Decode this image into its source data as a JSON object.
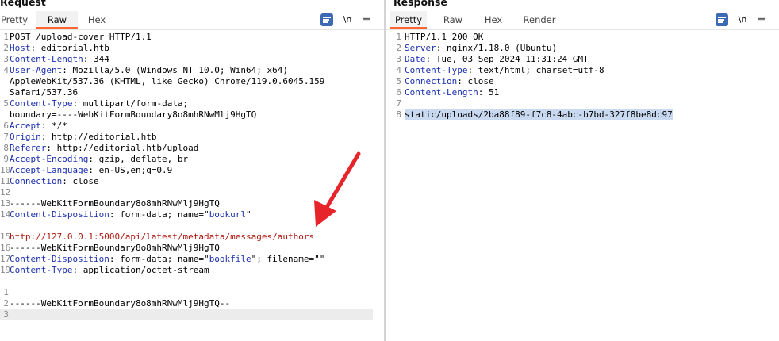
{
  "request": {
    "title": "Request",
    "tabs": [
      "Pretty",
      "Raw",
      "Hex"
    ],
    "active_tab": "Raw",
    "toolbar": {
      "newline_label": "\\n",
      "menu_label": "≡"
    },
    "lines": [
      {
        "num": "1",
        "parts": [
          {
            "t": "POST /upload-cover HTTP/1.1",
            "c": ""
          }
        ]
      },
      {
        "num": "2",
        "parts": [
          {
            "t": "Host",
            "c": "hn"
          },
          {
            "t": ": editorial.htb",
            "c": ""
          }
        ]
      },
      {
        "num": "3",
        "parts": [
          {
            "t": "Content-Length",
            "c": "hn"
          },
          {
            "t": ": 344",
            "c": ""
          }
        ]
      },
      {
        "num": "4",
        "parts": [
          {
            "t": "User-Agent",
            "c": "hn"
          },
          {
            "t": ": Mozilla/5.0 (Windows NT 10.0; Win64; x64)",
            "c": ""
          }
        ]
      },
      {
        "num": "",
        "parts": [
          {
            "t": "AppleWebKit/537.36 (KHTML, like Gecko) Chrome/119.0.6045.159",
            "c": ""
          }
        ]
      },
      {
        "num": "",
        "parts": [
          {
            "t": "Safari/537.36",
            "c": ""
          }
        ]
      },
      {
        "num": "5",
        "parts": [
          {
            "t": "Content-Type",
            "c": "hn"
          },
          {
            "t": ": multipart/form-data;",
            "c": ""
          }
        ]
      },
      {
        "num": "",
        "parts": [
          {
            "t": "boundary=----WebKitFormBoundary8o8mhRNwMlj9HgTQ",
            "c": ""
          }
        ]
      },
      {
        "num": "6",
        "parts": [
          {
            "t": "Accept",
            "c": "hn"
          },
          {
            "t": ": */*",
            "c": ""
          }
        ]
      },
      {
        "num": "7",
        "parts": [
          {
            "t": "Origin",
            "c": "hn"
          },
          {
            "t": ": http://editorial.htb",
            "c": ""
          }
        ]
      },
      {
        "num": "8",
        "parts": [
          {
            "t": "Referer",
            "c": "hn"
          },
          {
            "t": ": http://editorial.htb/upload",
            "c": ""
          }
        ]
      },
      {
        "num": "9",
        "parts": [
          {
            "t": "Accept-Encoding",
            "c": "hn"
          },
          {
            "t": ": gzip, deflate, br",
            "c": ""
          }
        ]
      },
      {
        "num": "10",
        "parts": [
          {
            "t": "Accept-Language",
            "c": "hn"
          },
          {
            "t": ": en-US,en;q=0.9",
            "c": ""
          }
        ]
      },
      {
        "num": "11",
        "parts": [
          {
            "t": "Connection",
            "c": "hn"
          },
          {
            "t": ": close",
            "c": ""
          }
        ]
      },
      {
        "num": "12",
        "parts": []
      },
      {
        "num": "13",
        "parts": [
          {
            "t": "------WebKitFormBoundary8o8mhRNwMlj9HgTQ",
            "c": ""
          }
        ]
      },
      {
        "num": "14",
        "parts": [
          {
            "t": "Content-Disposition",
            "c": "hn"
          },
          {
            "t": ": form-data; name=\"",
            "c": ""
          },
          {
            "t": "bookurl",
            "c": "hn"
          },
          {
            "t": "\"",
            "c": ""
          }
        ]
      },
      {
        "num": "",
        "parts": []
      },
      {
        "num": "15",
        "parts": [
          {
            "t": "http://127.0.0.1:5000/api/latest/metadata/messages/authors",
            "c": "url"
          }
        ]
      },
      {
        "num": "16",
        "parts": [
          {
            "t": "------WebKitFormBoundary8o8mhRNwMlj9HgTQ",
            "c": ""
          }
        ]
      },
      {
        "num": "17",
        "parts": [
          {
            "t": "Content-Disposition",
            "c": "hn"
          },
          {
            "t": ": form-data; name=\"",
            "c": ""
          },
          {
            "t": "bookfile",
            "c": "hn"
          },
          {
            "t": "\"; filename=\"\"",
            "c": ""
          }
        ]
      },
      {
        "num": "19",
        "parts": [
          {
            "t": "Content-Type",
            "c": "hn"
          },
          {
            "t": ": application/octet-stream",
            "c": ""
          }
        ]
      },
      {
        "num": "",
        "parts": []
      },
      {
        "num": "1",
        "parts": []
      },
      {
        "num": "2",
        "parts": [
          {
            "t": "------WebKitFormBoundary8o8mhRNwMlj9HgTQ--",
            "c": ""
          }
        ]
      },
      {
        "num": "3",
        "parts": []
      }
    ]
  },
  "response": {
    "title": "Response",
    "tabs": [
      "Pretty",
      "Raw",
      "Hex",
      "Render"
    ],
    "active_tab": "Pretty",
    "toolbar": {
      "newline_label": "\\n",
      "menu_label": "≡"
    },
    "lines": [
      {
        "num": "1",
        "parts": [
          {
            "t": "HTTP/1.1 200 OK",
            "c": ""
          }
        ]
      },
      {
        "num": "2",
        "parts": [
          {
            "t": "Server",
            "c": "hn"
          },
          {
            "t": ": nginx/1.18.0 (Ubuntu)",
            "c": ""
          }
        ]
      },
      {
        "num": "3",
        "parts": [
          {
            "t": "Date",
            "c": "hn"
          },
          {
            "t": ": Tue, 03 Sep 2024 11:31:24 GMT",
            "c": ""
          }
        ]
      },
      {
        "num": "4",
        "parts": [
          {
            "t": "Content-Type",
            "c": "hn"
          },
          {
            "t": ": text/html; charset=utf-8",
            "c": ""
          }
        ]
      },
      {
        "num": "5",
        "parts": [
          {
            "t": "Connection",
            "c": "hn"
          },
          {
            "t": ": close",
            "c": ""
          }
        ]
      },
      {
        "num": "6",
        "parts": [
          {
            "t": "Content-Length",
            "c": "hn"
          },
          {
            "t": ": 51",
            "c": ""
          }
        ]
      },
      {
        "num": "7",
        "parts": []
      },
      {
        "num": "8",
        "parts": [
          {
            "t": "static/uploads/2ba88f89-f7c8-4abc-b7bd-327f8be8dc97",
            "c": "sel"
          }
        ]
      }
    ]
  },
  "colors": {
    "header_name": "#1a2fb0",
    "url": "#b0160e",
    "selection": "#c9d9f0",
    "active_tab_underline": "#ff6633",
    "arrow": "#e8242b",
    "toolbar_icon": "#3d6bb3"
  },
  "annotation": {
    "icon": "arrow-icon",
    "color": "#e8242b"
  }
}
